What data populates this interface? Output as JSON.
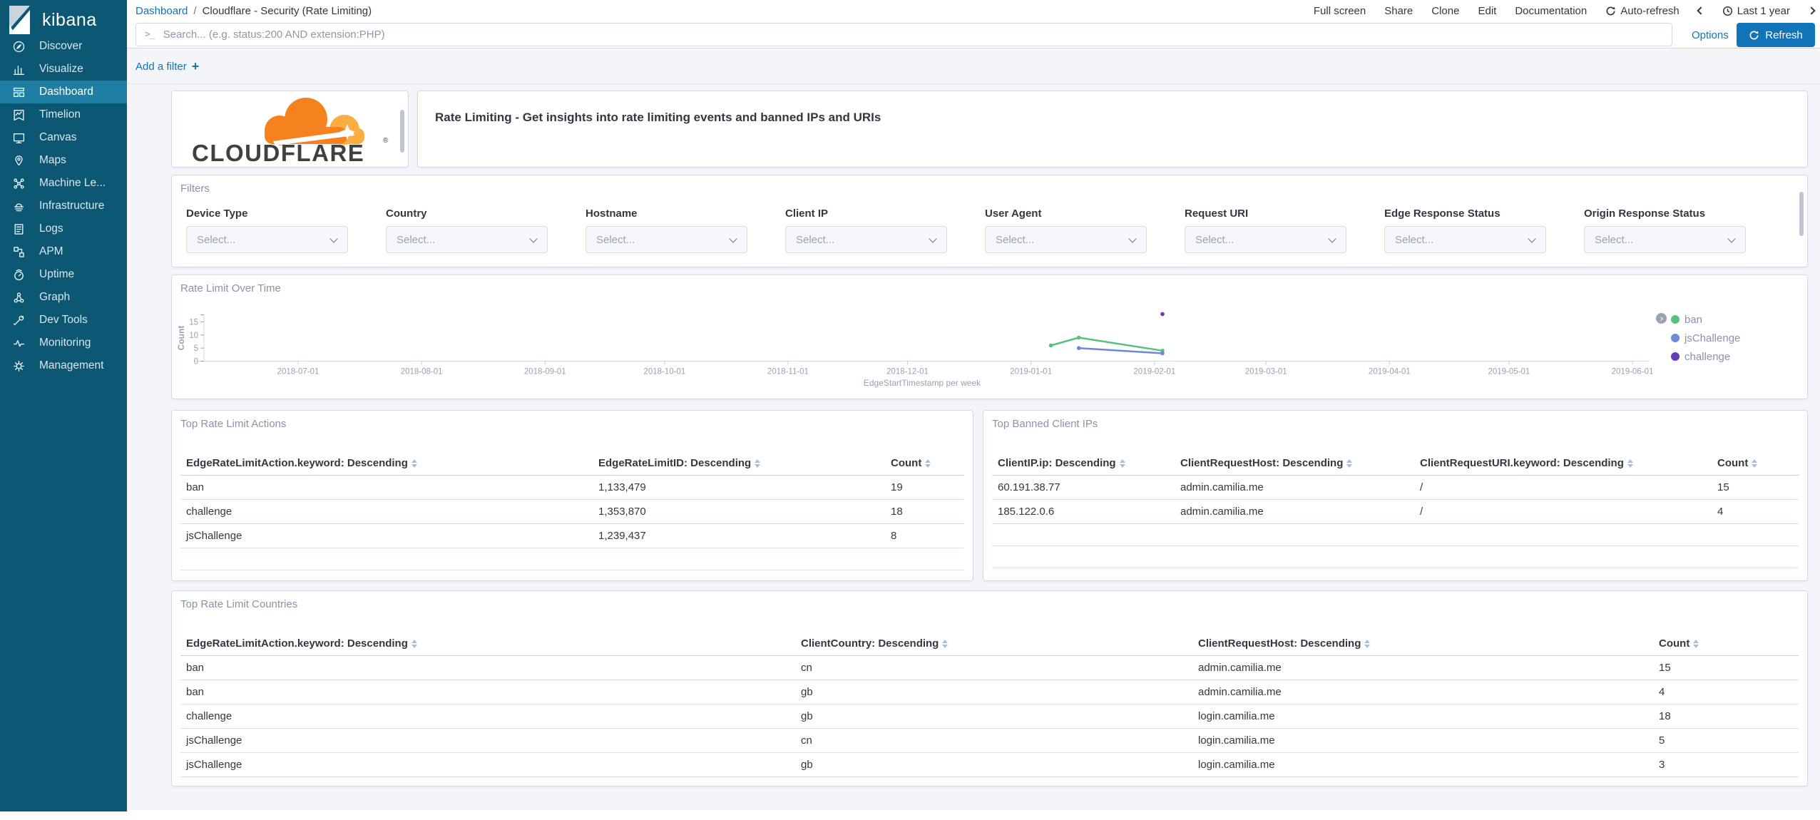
{
  "colors": {
    "accent_blue": "#1173B8",
    "sidebar_bg": "#0C5874",
    "sidebar_selected_bg": "#1E7EA4",
    "panel_border": "#D3DAE6",
    "page_bg": "#F4F5F9",
    "cloudflare_orange": "#F6821F",
    "cloudflare_light_orange": "#FBAD41"
  },
  "sidebar": {
    "logo_text": "kibana",
    "items": [
      {
        "label": "Discover",
        "icon": "discover-icon",
        "selected": false
      },
      {
        "label": "Visualize",
        "icon": "visualize-icon",
        "selected": false
      },
      {
        "label": "Dashboard",
        "icon": "dashboard-icon",
        "selected": true
      },
      {
        "label": "Timelion",
        "icon": "timelion-icon",
        "selected": false
      },
      {
        "label": "Canvas",
        "icon": "canvas-icon",
        "selected": false
      },
      {
        "label": "Maps",
        "icon": "maps-icon",
        "selected": false
      },
      {
        "label": "Machine Le...",
        "icon": "machine-learning-icon",
        "selected": false
      },
      {
        "label": "Infrastructure",
        "icon": "infrastructure-icon",
        "selected": false
      },
      {
        "label": "Logs",
        "icon": "logs-icon",
        "selected": false
      },
      {
        "label": "APM",
        "icon": "apm-icon",
        "selected": false
      },
      {
        "label": "Uptime",
        "icon": "uptime-icon",
        "selected": false
      },
      {
        "label": "Graph",
        "icon": "graph-icon",
        "selected": false
      },
      {
        "label": "Dev Tools",
        "icon": "dev-tools-icon",
        "selected": false
      },
      {
        "label": "Monitoring",
        "icon": "monitoring-icon",
        "selected": false
      },
      {
        "label": "Management",
        "icon": "management-icon",
        "selected": false
      }
    ]
  },
  "topnav": {
    "breadcrumb": {
      "root": "Dashboard",
      "sep": "/",
      "current": "Cloudflare - Security (Rate Limiting)"
    },
    "menu": [
      "Full screen",
      "Share",
      "Clone",
      "Edit",
      "Documentation"
    ],
    "auto_refresh_label": "Auto-refresh",
    "time_range_label": "Last 1 year",
    "search": {
      "placeholder": "Search... (e.g. status:200 AND extension:PHP)",
      "value": ""
    },
    "options_label": "Options",
    "refresh_label": "Refresh",
    "add_filter_label": "Add a filter"
  },
  "panels": {
    "logo": {
      "brand": "CLOUDFLARE",
      "reg": "®"
    },
    "header": {
      "title": "Rate Limiting - Get insights into rate limiting events and banned IPs and URIs"
    },
    "filters": {
      "title": "Filters",
      "select_placeholder": "Select...",
      "fields": [
        "Device Type",
        "Country",
        "Hostname",
        "Client IP",
        "User Agent",
        "Request URI",
        "Edge Response Status",
        "Origin Response Status"
      ]
    },
    "actions_table": {
      "title": "Top Rate Limit Actions",
      "columns": [
        "EdgeRateLimitAction.keyword: Descending",
        "EdgeRateLimitID: Descending",
        "Count"
      ],
      "rows": [
        [
          "ban",
          "1,133,479",
          "19"
        ],
        [
          "challenge",
          "1,353,870",
          "18"
        ],
        [
          "jsChallenge",
          "1,239,437",
          "8"
        ]
      ],
      "empty_rows": 1
    },
    "banned_table": {
      "title": "Top Banned Client IPs",
      "columns": [
        "ClientIP.ip: Descending",
        "ClientRequestHost: Descending",
        "ClientRequestURI.keyword: Descending",
        "Count"
      ],
      "rows": [
        [
          "60.191.38.77",
          "admin.camilia.me",
          "/",
          "15"
        ],
        [
          "185.122.0.6",
          "admin.camilia.me",
          "/",
          "4"
        ]
      ],
      "empty_rows": 2
    },
    "countries_table": {
      "title": "Top Rate Limit Countries",
      "columns": [
        "EdgeRateLimitAction.keyword: Descending",
        "ClientCountry: Descending",
        "ClientRequestHost: Descending",
        "Count"
      ],
      "rows": [
        [
          "ban",
          "cn",
          "admin.camilia.me",
          "15"
        ],
        [
          "ban",
          "gb",
          "admin.camilia.me",
          "4"
        ],
        [
          "challenge",
          "gb",
          "login.camilia.me",
          "18"
        ],
        [
          "jsChallenge",
          "cn",
          "login.camilia.me",
          "5"
        ],
        [
          "jsChallenge",
          "gb",
          "login.camilia.me",
          "3"
        ]
      ],
      "empty_rows": 0
    }
  },
  "chart_data": {
    "type": "line",
    "title": "Rate Limit Over Time",
    "xlabel": "EdgeStartTimestamp per week",
    "ylabel": "Count",
    "x_ticks": [
      "2018-07-01",
      "2018-08-01",
      "2018-09-01",
      "2018-10-01",
      "2018-11-01",
      "2018-12-01",
      "2019-01-01",
      "2019-02-01",
      "2019-03-01",
      "2019-04-01",
      "2019-05-01",
      "2019-06-01"
    ],
    "y_ticks": [
      0,
      5,
      10,
      15
    ],
    "ylim": [
      0,
      17.7
    ],
    "grid": false,
    "legend_position": "right",
    "series": [
      {
        "name": "ban",
        "color": "#57C17B",
        "points": [
          [
            "2019-01-06",
            6
          ],
          [
            "2019-01-13",
            9
          ],
          [
            "2019-02-03",
            4
          ]
        ]
      },
      {
        "name": "jsChallenge",
        "color": "#6F87D8",
        "points": [
          [
            "2019-01-13",
            5
          ],
          [
            "2019-02-03",
            3
          ]
        ]
      },
      {
        "name": "challenge",
        "color": "#663DB8",
        "points": [
          [
            "2019-02-03",
            18
          ]
        ]
      }
    ]
  }
}
